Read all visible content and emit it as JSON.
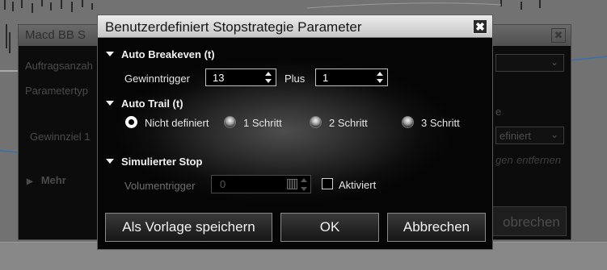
{
  "back_window": {
    "title": "Macd BB S",
    "close_glyph": "✖",
    "label_auftrag": "Auftragsanzah",
    "label_parametertyp": "Parametertyp",
    "label_gewinnziel": "Gewinnziel 1",
    "label_mehr": "Mehr",
    "label_e": "e",
    "select_value": "efiniert",
    "link_left": "gen",
    "link_right": "entfernen",
    "cancel_label": "obrechen"
  },
  "dialog": {
    "title": "Benutzerdefiniert Stopstrategie Parameter",
    "close_glyph": "✖",
    "auto_breakeven": {
      "heading": "Auto Breakeven (t)",
      "gewinntrigger_label": "Gewinntrigger",
      "gewinntrigger_value": "13",
      "plus_label": "Plus",
      "plus_value": "1"
    },
    "auto_trail": {
      "heading": "Auto Trail (t)",
      "options": [
        "Nicht definiert",
        "1 Schritt",
        "2 Schritt",
        "3 Schritt"
      ],
      "selected": "Nicht definiert"
    },
    "simulated_stop": {
      "heading": "Simulierter Stop",
      "volumentrigger_label": "Volumentrigger",
      "volumentrigger_value": "0",
      "aktiviert_label": "Aktiviert",
      "aktiviert_checked": false
    },
    "buttons": {
      "save_template": "Als Vorlage speichern",
      "ok": "OK",
      "cancel": "Abbrechen"
    }
  }
}
